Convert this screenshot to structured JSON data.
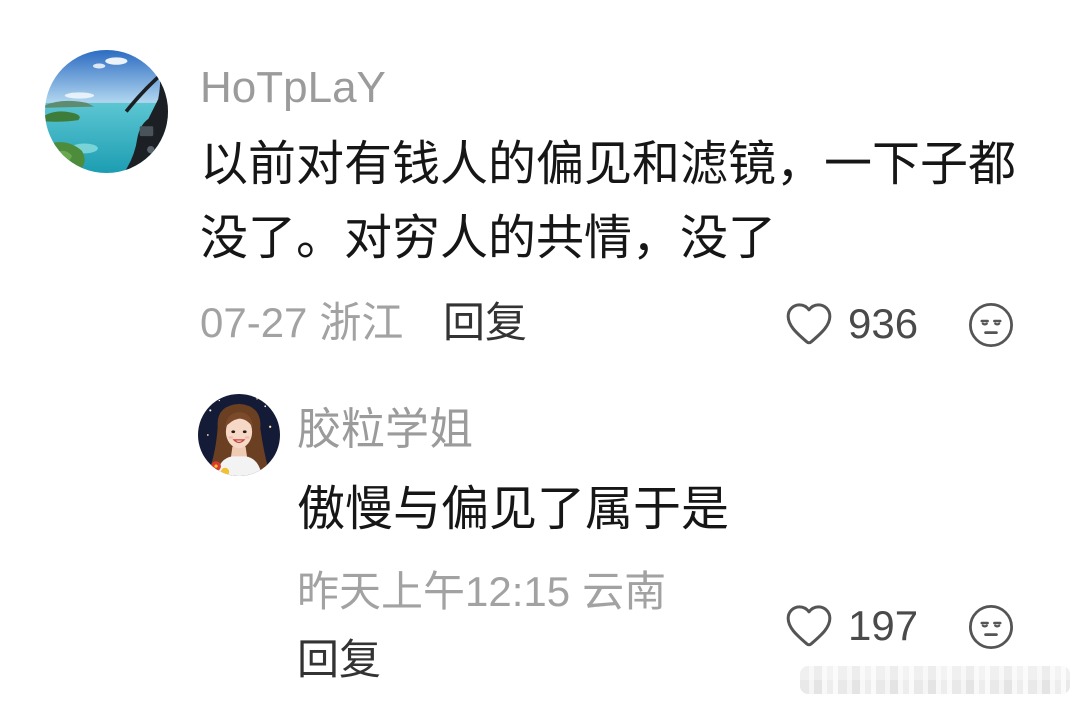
{
  "colors": {
    "background": "#ffffff",
    "username": "#9b9b9b",
    "comment_text": "#161616",
    "meta_text": "#a2a2a2",
    "reply_action": "#333333",
    "count_text": "#4a4a4a",
    "icon_stroke": "#555555"
  },
  "comment": {
    "username": "HoTpLaY",
    "text": "以前对有钱人的偏见和滤镜，一下子都没了。对穷人的共情，没了",
    "date": "07-27",
    "location": "浙江",
    "reply_label": "回复",
    "like_icon": "heart-outline-icon",
    "like_count": "936",
    "dislike_icon": "unamused-face-icon",
    "reply": {
      "username": "胶粒学姐",
      "text": "傲慢与偏见了属于是",
      "time": "昨天上午12:15",
      "location": "云南",
      "reply_label": "回复",
      "like_icon": "heart-outline-icon",
      "like_count": "197",
      "dislike_icon": "unamused-face-icon"
    }
  }
}
